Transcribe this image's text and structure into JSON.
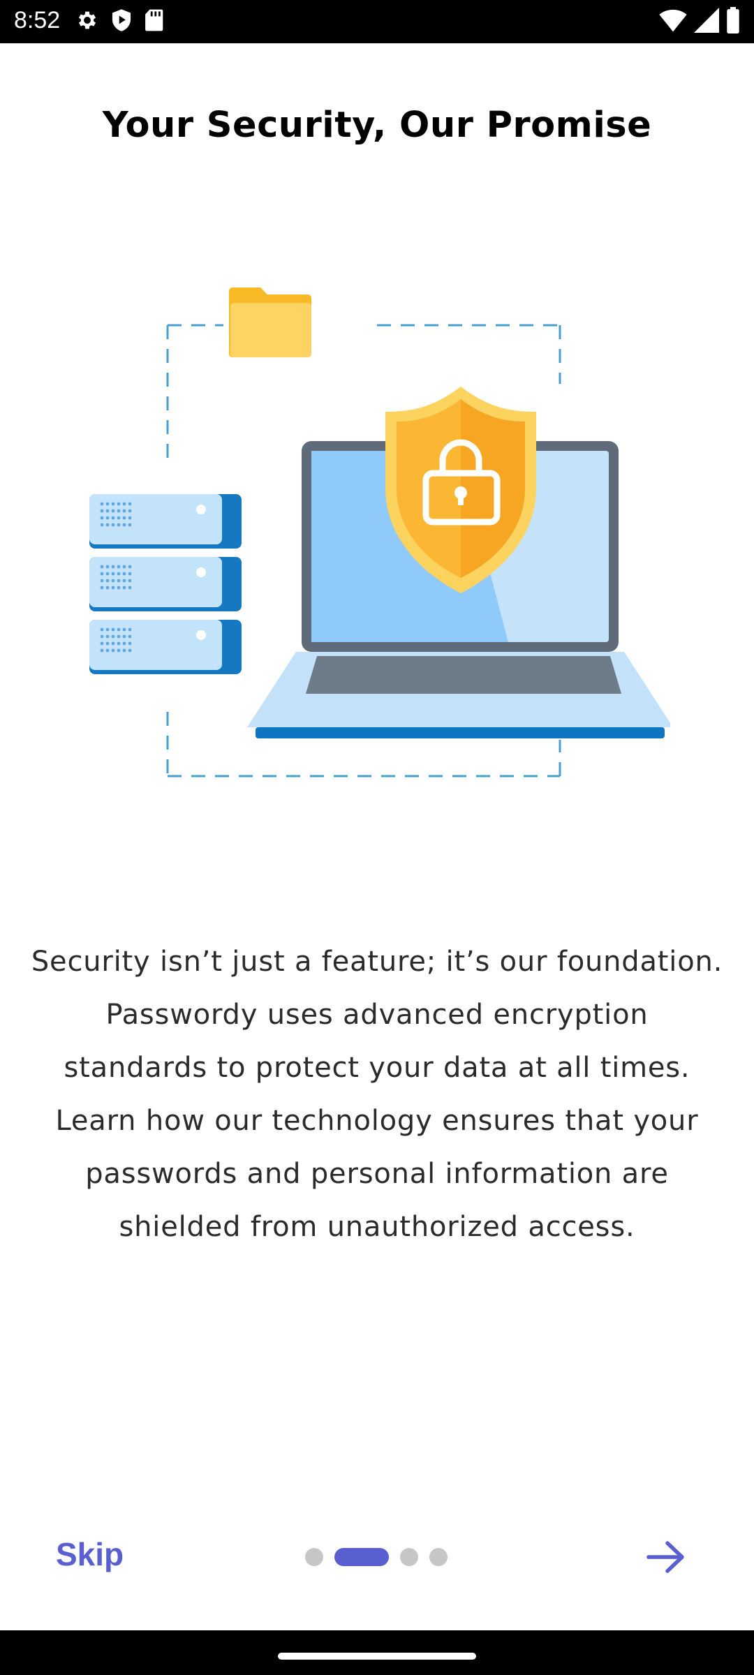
{
  "status_bar": {
    "time": "8:52",
    "left_icons": [
      "gear-icon",
      "play-protect-icon",
      "sd-card-icon"
    ],
    "right_icons": [
      "wifi-icon",
      "cell-signal-icon",
      "battery-icon"
    ]
  },
  "onboarding": {
    "title": "Your Security, Our Promise",
    "description": "Security isn’t just a feature; it’s our foundation.\nPasswordy uses  advanced encryption\nstandards to protect your data at all times.\nLearn how our technology ensures that your\npasswords and personal information are\nshielded from unauthorized access.",
    "illustration": "laptop-shield-server-folder-illustration",
    "skip_label": "Skip",
    "next_icon": "arrow-right-icon",
    "pager": {
      "total": 4,
      "active_index": 1
    }
  },
  "colors": {
    "accent": "#5a5fcf",
    "inactive_dot": "#c6c6c6",
    "shield": "#fbb634",
    "laptop_screen": "#90cafa",
    "server": "#1578c2"
  }
}
